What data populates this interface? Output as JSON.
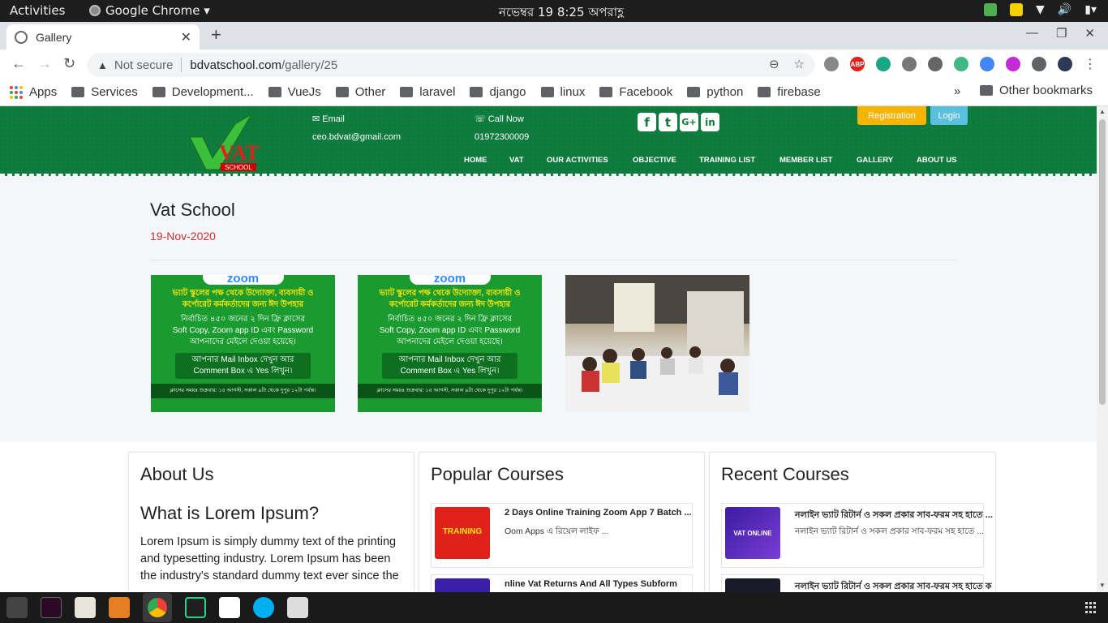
{
  "topbar": {
    "activities": "Activities",
    "app_name": "Google Chrome ▾",
    "clock": "নভেম্বর 19   8:25 অপরাহ্ণ"
  },
  "browser": {
    "tab_title": "Gallery",
    "not_secure": "Not secure",
    "url_host": "bdvatschool.com",
    "url_path": "/gallery/25",
    "bookmarks": [
      "Apps",
      "Services",
      "Development...",
      "VueJs",
      "Other",
      "laravel",
      "django",
      "linux",
      "Facebook",
      "python",
      "firebase"
    ],
    "other_bookmarks": "Other bookmarks",
    "more": "»",
    "ext_abp": "ABP"
  },
  "header": {
    "email_label": "✉ Email",
    "email": "ceo.bdvat@gmail.com",
    "call_label": "☏ Call Now",
    "phone": "01972300009",
    "registration": "Registration",
    "login": "Login",
    "social": [
      "f",
      "t",
      "G+",
      "in"
    ],
    "nav": [
      "HOME",
      "VAT",
      "OUR ACTIVITIES",
      "OBJECTIVE",
      "TRAINING LIST",
      "MEMBER LIST",
      "GALLERY",
      "ABOUT US"
    ],
    "logo_text": "VAT",
    "logo_sub": "SCHOOL"
  },
  "gallery": {
    "title": "Vat School",
    "date": "19-Nov-2020",
    "promo": {
      "zoom": "zoom",
      "line1": "ভ্যাট স্কুলের পক্ষ থেকে উদ্যোক্তা, ব্যবসায়ী ও",
      "line2": "কর্পোরেট কর্মকর্তাদের জন্য ঈদ উপহার",
      "line3": "নির্বাচিত ৪৫০ জনের ২ দিন ফ্রি ক্লাসের",
      "line4": "Soft Copy, Zoom app ID এবং Password",
      "line5": "আপনাদের মেইলে দেওয়া হয়েছে।",
      "line6": "আপনার Mail Inbox দেখুন আর",
      "line7": "Comment Box এ Yes লিখুন।",
      "bottom": "ক্লাসের সময়ঃ শুক্রবার: ১৫ আগস্ট, সকাল ৯টা থেকে দুপুর ১২টা পর্যন্ত।"
    }
  },
  "about": {
    "heading": "About Us",
    "subheading": "What is Lorem Ipsum?",
    "body": "Lorem Ipsum is simply dummy text of the printing and typesetting industry. Lorem Ipsum has been the industry's standard dummy text ever since the"
  },
  "popular": {
    "heading": "Popular Courses",
    "items": [
      {
        "title": "2 Days Online Training Zoom App 7 Batch ...",
        "sub": "Oom Apps এ রিয়েল লাইফ ...",
        "img_text": "TRAINING"
      },
      {
        "title": "nline Vat Returns And All Types Subform",
        "sub": "",
        "img_text": ""
      }
    ]
  },
  "recent": {
    "heading": "Recent Courses",
    "items": [
      {
        "title": "নলাইন ভ্যাট রিটার্ন ও সকল প্রকার সাব-ফরম সহ হাতে ...",
        "sub": "নলাইন ভ্যাট রিটার্ন ও সকল প্রকার সাব-ফরম সহ হাতে ...",
        "img_text": "VAT ONLINE"
      },
      {
        "title": "নলাইন ভ্যাট রিটার্ন ও সকল প্রকার সাব-ফরম সহ হাতে ক",
        "sub": "",
        "img_text": ""
      }
    ]
  }
}
